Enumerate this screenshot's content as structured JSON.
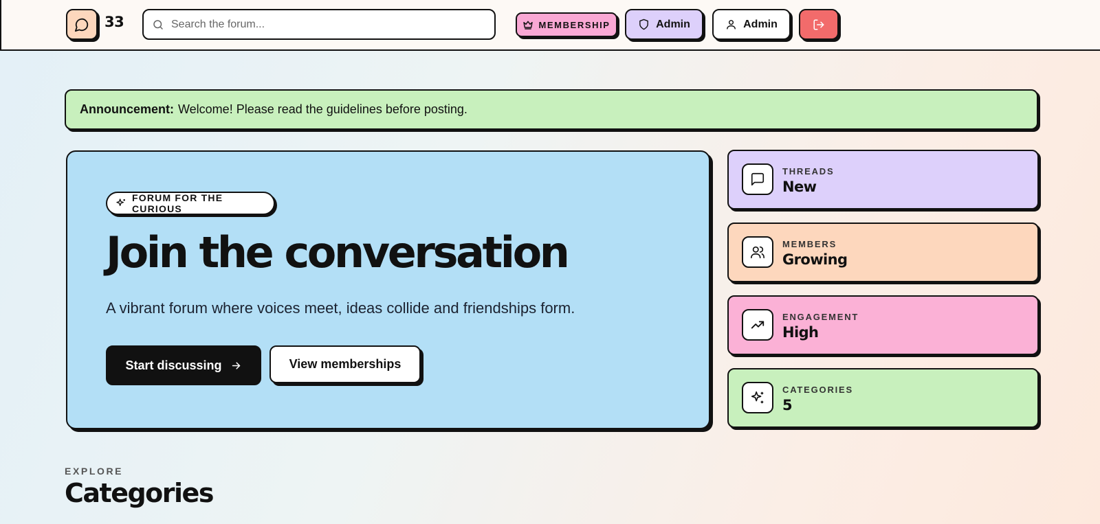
{
  "header": {
    "logo_count": "33",
    "search_placeholder": "Search the forum...",
    "membership_label": "MEMBERSHIP",
    "admin_panel_label": "Admin",
    "admin_user_label": "Admin"
  },
  "announcement": {
    "prefix": "Announcement:",
    "text": "Welcome! Please read the guidelines before posting."
  },
  "hero": {
    "tagline": "FORUM FOR THE CURIOUS",
    "title": "Join the conversation",
    "subtitle": "A vibrant forum where voices meet, ideas collide and friendships form.",
    "primary_cta": "Start discussing",
    "secondary_cta": "View memberships"
  },
  "stats": [
    {
      "label": "THREADS",
      "value": "New",
      "icon": "message-square-icon",
      "color": "#ddd0fb"
    },
    {
      "label": "MEMBERS",
      "value": "Growing",
      "icon": "users-icon",
      "color": "#fdd7bd"
    },
    {
      "label": "ENGAGEMENT",
      "value": "High",
      "icon": "trending-up-icon",
      "color": "#fbb1d6"
    },
    {
      "label": "CATEGORIES",
      "value": "5",
      "icon": "sparkles-icon",
      "color": "#c8f0bd"
    }
  ],
  "explore": {
    "eyebrow": "EXPLORE",
    "title": "Categories"
  }
}
